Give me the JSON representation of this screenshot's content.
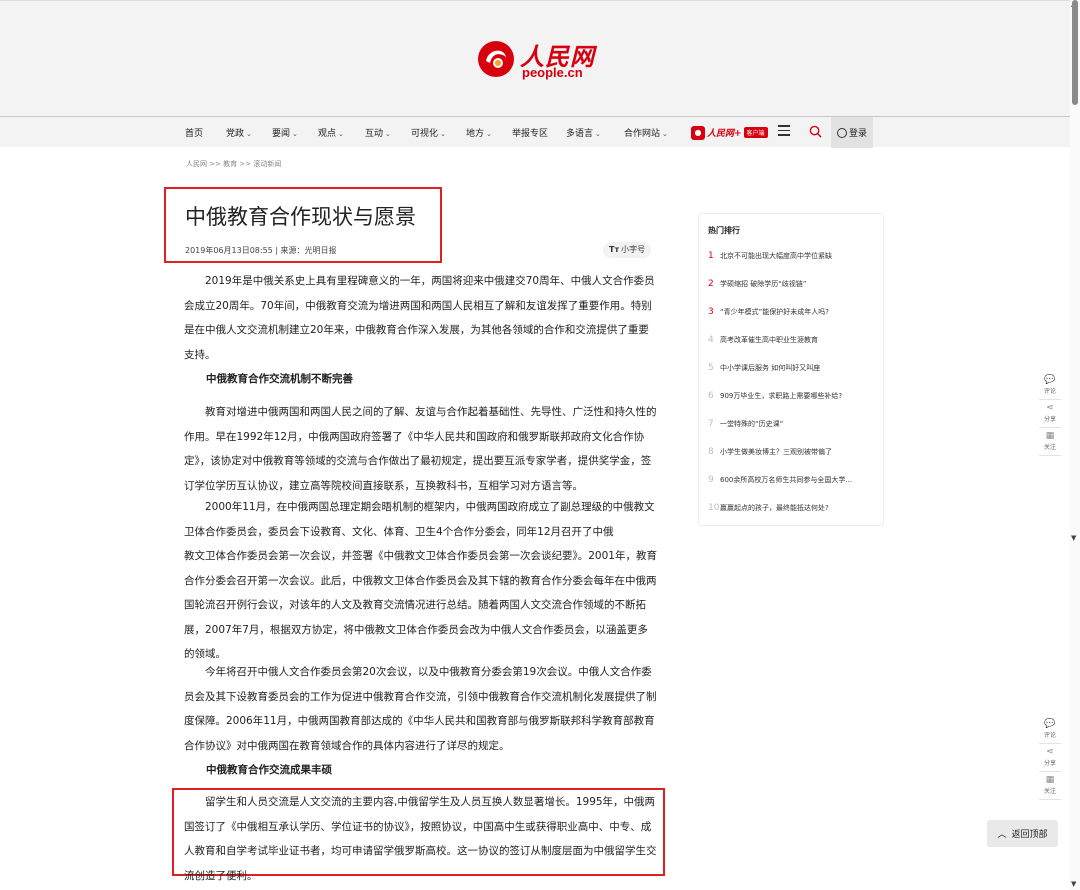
{
  "logo": {
    "cn": "人民网",
    "en": "people.cn"
  },
  "nav": {
    "items": [
      {
        "label": "首页",
        "chevron": false
      },
      {
        "label": "党政",
        "chevron": true
      },
      {
        "label": "要闻",
        "chevron": true
      },
      {
        "label": "观点",
        "chevron": true
      },
      {
        "label": "互动",
        "chevron": true
      },
      {
        "label": "可视化",
        "chevron": true
      },
      {
        "label": "地方",
        "chevron": true
      },
      {
        "label": "举报专区",
        "chevron": false
      },
      {
        "label": "多语言",
        "chevron": true
      },
      {
        "label": "合作网站",
        "chevron": true
      }
    ],
    "app_name": "人民网+",
    "app_pill": "客户端",
    "login": "登录",
    "colors": {
      "brand": "#d7000f"
    }
  },
  "breadcrumb": "人民网 >> 教育 >> 滚动新闻",
  "article": {
    "title": "中俄教育合作现状与愿景",
    "meta": "2019年06月13日08:55 | 来源：光明日报",
    "font_toggle_icon": "Tт",
    "font_toggle": "小字号",
    "p1": "2019年是中俄关系史上具有里程碑意义的一年，两国将迎来中俄建交70周年、中俄人文合作委员会成立20周年。70年间，中俄教育交流为增进两国和两国人民相互了解和友谊发挥了重要作用。特别是在中俄人文交流机制建立20年来，中俄教育合作深入发展，为其他各领域的合作和交流提供了重要支持。",
    "h1": "中俄教育合作交流机制不断完善",
    "p2": "教育对增进中俄两国和两国人民之间的了解、友谊与合作起着基础性、先导性、广泛性和持久性的作用。早在1992年12月，中俄两国政府签署了《中华人民共和国政府和俄罗斯联邦政府文化合作协定》，该协定对中俄教育等领域的交流与合作做出了最初规定，提出要互派专家学者，提供奖学金，签订学位学历互认协议，建立高等院校间直接联系，互换教科书，互相学习对方语言等。",
    "p3a": "2000年11月，在中俄两国总理定期会晤机制的框架内，中俄两国政府成立了副总理级的中俄教文卫体合作委员会，委员会下设教育、文化、体育、卫生4个合作分委会，同年12月召开了中俄",
    "p3b": "教文卫体合作委员会第一次会议，并签署《中俄教文卫体合作委员会第一次会谈纪要》。2001年，教育合作分委会召开第一次会议。此后，中俄教文卫体合作委员会及其下辖的教育合作分委会每年在中俄两国轮流召开例行会议，对该年的人文及教育交流情况进行总结。随着两国人文交流合作领域的不断拓展，2007年7月，根据双方协定，将中俄教文卫体合作委员会改为中俄人文合作委员会，以涵盖更多的领域。",
    "p4": "今年将召开中俄人文合作委员会第20次会议，以及中俄教育分委会第19次会议。中俄人文合作委员会及其下设教育委员会的工作为促进中俄教育合作交流，引领中俄教育合作交流机制化发展提供了制度保障。2006年11月，中俄两国教育部达成的《中华人民共和国教育部与俄罗斯联邦科学教育部教育合作协议》对中俄两国在教育领域合作的具体内容进行了详尽的规定。",
    "h2": "中俄教育合作交流成果丰硕",
    "p5": "留学生和人员交流是人文交流的主要内容,中俄留学生及人员互换人数显著增长。1995年，中俄两国签订了《中俄相互承认学历、学位证书的协议》，按照协议，中国高中生或获得职业高中、中专、成人教育和自学考试毕业证书者，均可申请留学俄罗斯高校。这一协议的签订从制度层面为中俄留学生交流创造了便利。"
  },
  "hot": {
    "title": "热门排行",
    "items": [
      {
        "n": "1",
        "text": "北京不可能出现大幅度高中学位紧缺"
      },
      {
        "n": "2",
        "text": "学硕缩招 破除学历“歧视链”"
      },
      {
        "n": "3",
        "text": "“青少年模式”能保护好未成年人吗?"
      },
      {
        "n": "4",
        "text": "高考改革催生高中职业生涯教育"
      },
      {
        "n": "5",
        "text": "中小学课后服务 如何叫好又叫座"
      },
      {
        "n": "6",
        "text": "909万毕业生，求职路上需要哪些补给?"
      },
      {
        "n": "7",
        "text": "一堂特殊的“历史课”"
      },
      {
        "n": "8",
        "text": "小学生做美妆博主？三观别被带偏了"
      },
      {
        "n": "9",
        "text": "600余所高校万名师生共同参与全国大学..."
      },
      {
        "n": "10",
        "text": "赢赢起点的孩子，最终能抵达何处?"
      }
    ]
  },
  "tools": [
    {
      "icon": "comment-icon",
      "glyph": "💬",
      "label": "评论"
    },
    {
      "icon": "share-icon",
      "glyph": "⋖",
      "label": "分享"
    },
    {
      "icon": "follow-icon",
      "glyph": "▦",
      "label": "关注"
    }
  ],
  "back_top": {
    "icon": "chevron-up-icon",
    "label": "返回顶部"
  }
}
